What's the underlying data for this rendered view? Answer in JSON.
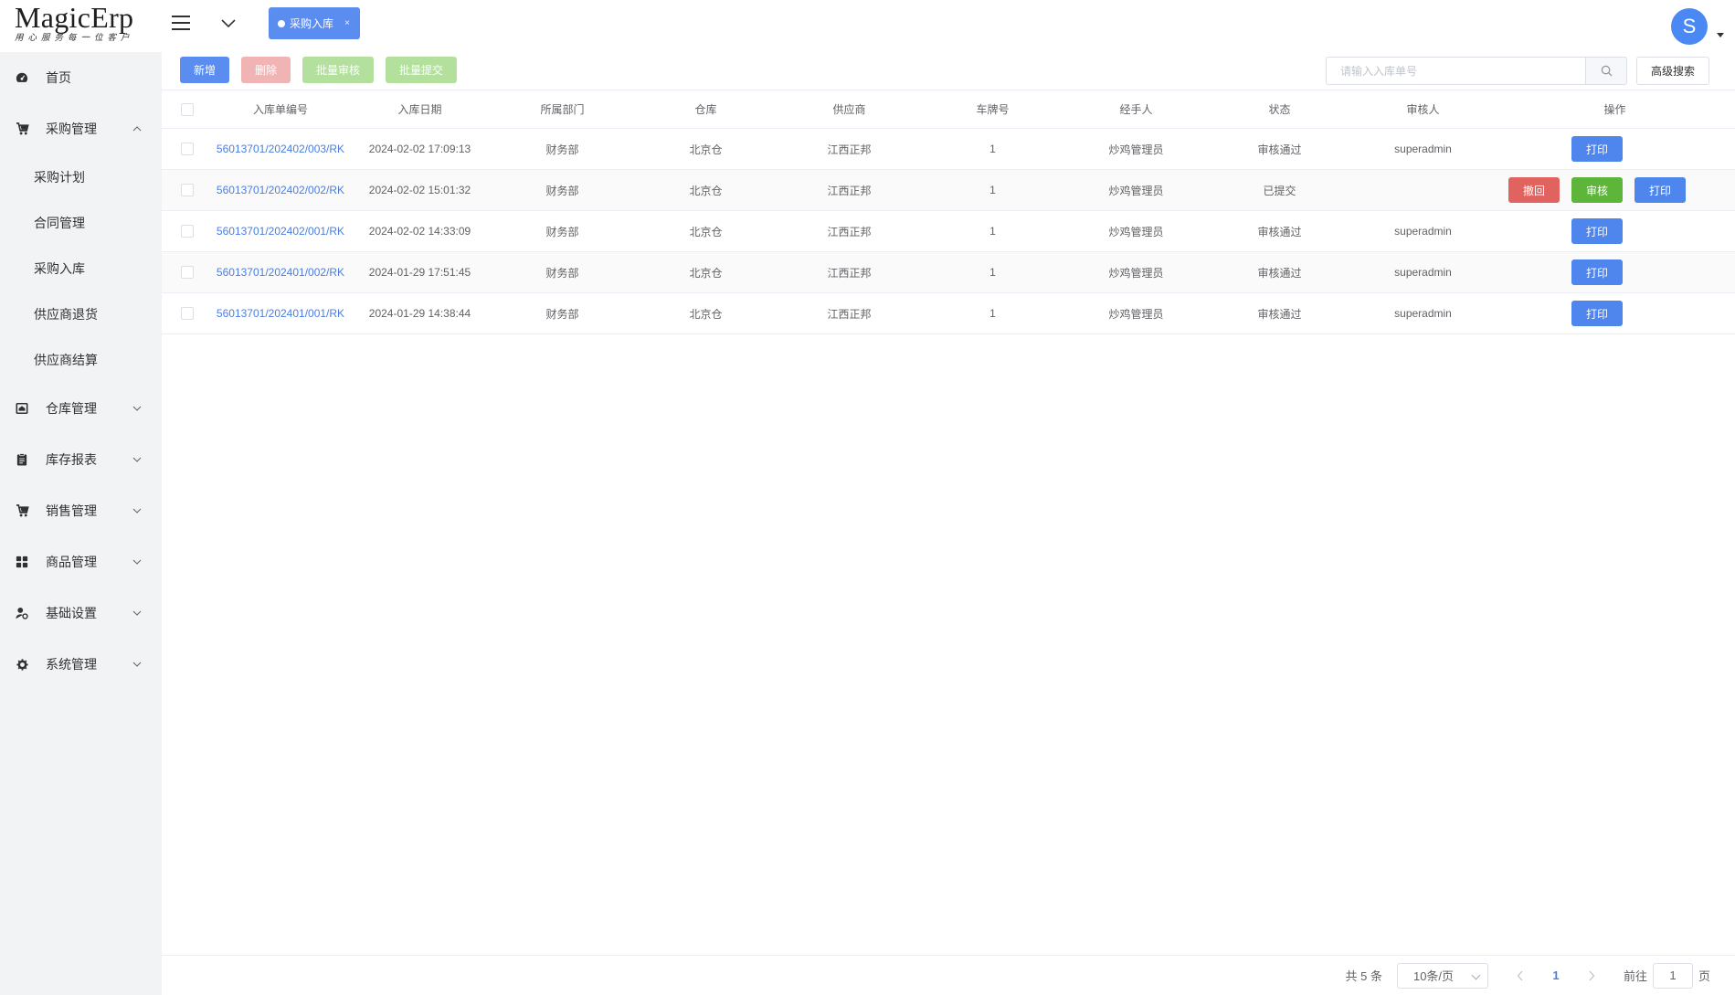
{
  "brand": {
    "name": "MagicErp",
    "slogan": "用心服务每一位客户"
  },
  "sidebar": {
    "home": {
      "label": "首页",
      "icon": "dashboard-icon"
    },
    "purchase": {
      "label": "采购管理",
      "icon": "cart-icon",
      "expanded": true,
      "children": [
        "采购计划",
        "合同管理",
        "采购入库",
        "供应商退货",
        "供应商结算"
      ]
    },
    "groups": [
      {
        "label": "仓库管理",
        "icon": "warehouse-icon"
      },
      {
        "label": "库存报表",
        "icon": "clipboard-icon"
      },
      {
        "label": "销售管理",
        "icon": "cart-icon"
      },
      {
        "label": "商品管理",
        "icon": "grid-icon"
      },
      {
        "label": "基础设置",
        "icon": "user-gear-icon"
      },
      {
        "label": "系统管理",
        "icon": "gear-icon"
      }
    ]
  },
  "header": {
    "active_tab": "采购入库",
    "tab_close": "×",
    "avatar_letter": "S"
  },
  "toolbar": {
    "add": "新增",
    "delete": "删除",
    "batch_audit": "批量审核",
    "batch_submit": "批量提交",
    "search_placeholder": "请输入入库单号",
    "advanced_search": "高级搜索"
  },
  "table": {
    "columns": [
      "入库单编号",
      "入库日期",
      "所属部门",
      "仓库",
      "供应商",
      "车牌号",
      "经手人",
      "状态",
      "审核人",
      "操作"
    ],
    "rows": [
      {
        "code": "56013701/202402/003/RK",
        "date": "2024-02-02 17:09:13",
        "dept": "财务部",
        "warehouse": "北京仓",
        "supplier": "江西正邦",
        "plate": "1",
        "handler": "炒鸡管理员",
        "status": "审核通过",
        "auditor": "superadmin",
        "actions": [
          "打印"
        ]
      },
      {
        "code": "56013701/202402/002/RK",
        "date": "2024-02-02 15:01:32",
        "dept": "财务部",
        "warehouse": "北京仓",
        "supplier": "江西正邦",
        "plate": "1",
        "handler": "炒鸡管理员",
        "status": "已提交",
        "auditor": "",
        "actions": [
          "撤回",
          "审核",
          "打印"
        ]
      },
      {
        "code": "56013701/202402/001/RK",
        "date": "2024-02-02 14:33:09",
        "dept": "财务部",
        "warehouse": "北京仓",
        "supplier": "江西正邦",
        "plate": "1",
        "handler": "炒鸡管理员",
        "status": "审核通过",
        "auditor": "superadmin",
        "actions": [
          "打印"
        ]
      },
      {
        "code": "56013701/202401/002/RK",
        "date": "2024-01-29 17:51:45",
        "dept": "财务部",
        "warehouse": "北京仓",
        "supplier": "江西正邦",
        "plate": "1",
        "handler": "炒鸡管理员",
        "status": "审核通过",
        "auditor": "superadmin",
        "actions": [
          "打印"
        ]
      },
      {
        "code": "56013701/202401/001/RK",
        "date": "2024-01-29 14:38:44",
        "dept": "财务部",
        "warehouse": "北京仓",
        "supplier": "江西正邦",
        "plate": "1",
        "handler": "炒鸡管理员",
        "status": "审核通过",
        "auditor": "superadmin",
        "actions": [
          "打印"
        ]
      }
    ]
  },
  "pagination": {
    "total": "共 5 条",
    "page_size": "10条/页",
    "current": "1",
    "goto_prefix": "前往",
    "goto_value": "1",
    "goto_suffix": "页"
  },
  "colors": {
    "primary": "#5b8cf0",
    "danger": "#e0635f",
    "success": "#5db63a",
    "link": "#4a7ee0"
  }
}
